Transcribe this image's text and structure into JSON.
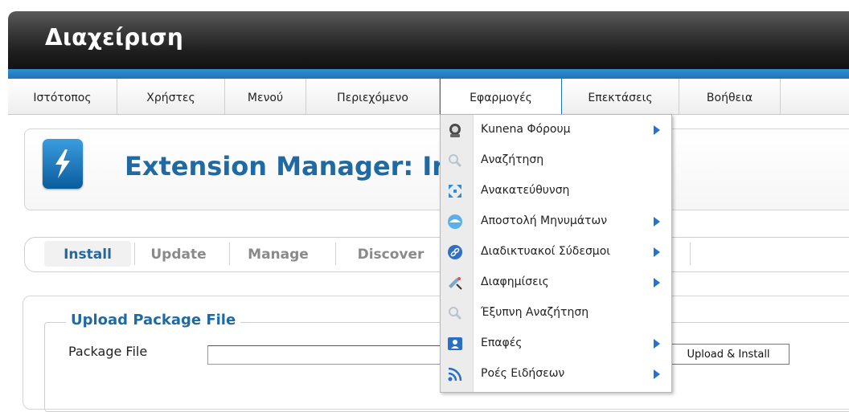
{
  "header": {
    "title": "Διαχείριση"
  },
  "menubar": {
    "items": [
      {
        "label": "Ιστότοπος"
      },
      {
        "label": "Χρήστες"
      },
      {
        "label": "Μενού"
      },
      {
        "label": "Περιεχόμενο"
      },
      {
        "label": "Εφαρμογές",
        "active": true
      },
      {
        "label": "Επεκτάσεις"
      },
      {
        "label": "Βοήθεια"
      }
    ]
  },
  "dropdown": {
    "items": [
      {
        "label": "Κunena Φόρουμ",
        "icon": "forum-icon",
        "submenu": true
      },
      {
        "label": "Αναζήτηση",
        "icon": "search-icon",
        "submenu": false
      },
      {
        "label": "Ανακατεύθυνση",
        "icon": "redirect-icon",
        "submenu": false
      },
      {
        "label": "Αποστολή Μηνυμάτων",
        "icon": "messaging-icon",
        "submenu": true
      },
      {
        "label": "Διαδικτυακοί Σύδεσμοι",
        "icon": "weblinks-icon",
        "submenu": true
      },
      {
        "label": "Διαφημίσεις",
        "icon": "banners-icon",
        "submenu": true
      },
      {
        "label": "Έξυπνη Αναζήτηση",
        "icon": "smart-search-icon",
        "submenu": false
      },
      {
        "label": "Επαφές",
        "icon": "contacts-icon",
        "submenu": true
      },
      {
        "label": "Ροές Ειδήσεων",
        "icon": "newsfeeds-icon",
        "submenu": true
      }
    ]
  },
  "toolbar": {
    "title": "Extension Manager: In"
  },
  "subnav": {
    "tabs": [
      {
        "label": "Install",
        "active": true
      },
      {
        "label": "Update"
      },
      {
        "label": "Manage"
      },
      {
        "label": "Discover"
      }
    ]
  },
  "upload": {
    "legend": "Upload Package File",
    "field_label": "Package File",
    "field_value": "",
    "button_label": "Upload & Install"
  },
  "colors": {
    "accent": "#1f74b8",
    "title_blue": "#1f6aa3",
    "header_dark": "#1e1e1e"
  }
}
